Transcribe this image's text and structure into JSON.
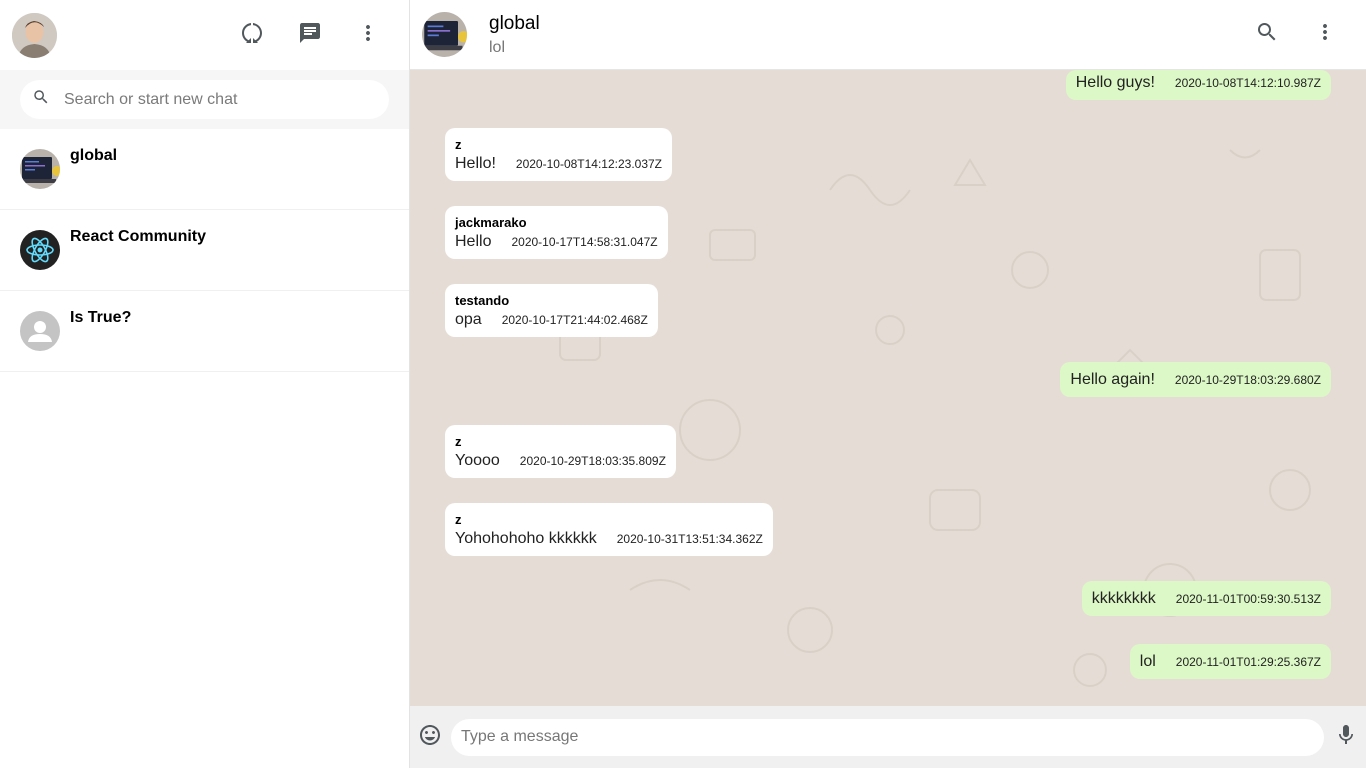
{
  "sidebar": {
    "search_placeholder": "Search or start new chat",
    "header_icons": [
      "status-icon",
      "new-chat-icon",
      "more-vert-icon"
    ],
    "chats": [
      {
        "name": "global",
        "avatar": "laptop-photo"
      },
      {
        "name": "React Community",
        "avatar": "react-logo"
      },
      {
        "name": "Is True?",
        "avatar": "default-person"
      }
    ]
  },
  "chat": {
    "title": "global",
    "subtitle": "lol",
    "messages": [
      {
        "sender": "",
        "text": "Hello guys!",
        "time": "2020-10-08T14:12:10.987Z",
        "sent": true
      },
      {
        "sender": "z",
        "text": "Hello!",
        "time": "2020-10-08T14:12:23.037Z",
        "sent": false
      },
      {
        "sender": "jackmarako",
        "text": "Hello",
        "time": "2020-10-17T14:58:31.047Z",
        "sent": false
      },
      {
        "sender": "testando",
        "text": "opa",
        "time": "2020-10-17T21:44:02.468Z",
        "sent": false
      },
      {
        "sender": "",
        "text": "Hello again!",
        "time": "2020-10-29T18:03:29.680Z",
        "sent": true
      },
      {
        "sender": "z",
        "text": "Yoooo",
        "time": "2020-10-29T18:03:35.809Z",
        "sent": false
      },
      {
        "sender": "z",
        "text": "Yohohohoho kkkkkk",
        "time": "2020-10-31T13:51:34.362Z",
        "sent": false
      },
      {
        "sender": "",
        "text": "kkkkkkkk",
        "time": "2020-11-01T00:59:30.513Z",
        "sent": true
      },
      {
        "sender": "",
        "text": "lol",
        "time": "2020-11-01T01:29:25.367Z",
        "sent": true
      }
    ]
  },
  "footer": {
    "input_placeholder": "Type a message"
  },
  "colors": {
    "sent_bubble": "#dcf8c6",
    "received_bubble": "#ffffff",
    "chat_background": "#e5ddd5",
    "icon": "#51585c"
  }
}
